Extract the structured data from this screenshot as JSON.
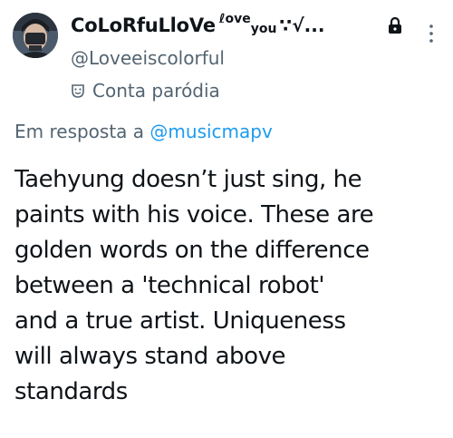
{
  "author": {
    "display_name": "CoLoRfuLloVe",
    "name_decoration_1": "ℓove",
    "name_decoration_2": "you",
    "name_decoration_3": "∵√...",
    "handle": "@Loveeiscolorful",
    "parody_label": "Conta paródia"
  },
  "reply": {
    "prefix": "Em resposta a",
    "target": "@musicmapv"
  },
  "tweet": {
    "lines": [
      "Taehyung doesn’t just sing, he",
      "paints with his voice. These are",
      "golden words on the difference",
      "between a 'technical robot'",
      "and a true artist. Uniqueness",
      "will always stand above",
      "standards"
    ]
  },
  "icons": {
    "lock": "lock-icon",
    "more": "more-icon",
    "parody": "theater-mask-icon"
  },
  "colors": {
    "text": "#0f1419",
    "secondary": "#536471",
    "link": "#1d9bf0"
  }
}
